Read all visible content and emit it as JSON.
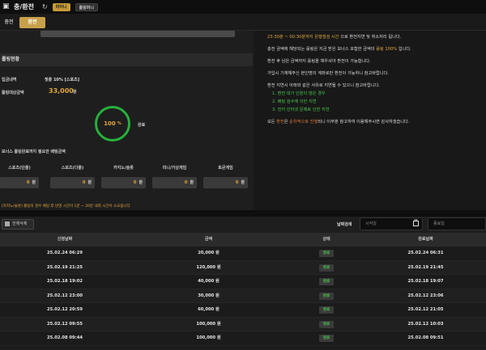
{
  "header": {
    "title": "충/환전",
    "pill_primary": "마이니",
    "pill_secondary": "롤링머니"
  },
  "tabs": [
    {
      "label": "충전"
    },
    {
      "label": "환전"
    }
  ],
  "left": {
    "input_stub": "⁣⁣⁣⁣⁣⁣⁣⁣⁣⁣⁣⁣⁣⁣",
    "section_title": "롤링현황",
    "deposit_label": "입금내역",
    "deposit_value": "첫충 10% [스포츠]",
    "target_label": "롤링대상금액",
    "target_value": "33,000",
    "target_unit": "원",
    "progress_value": 100,
    "progress_unit": "%",
    "progress_label": "완료",
    "bonus_label": "보너스 롤링완료까지 필요한 배팅금액",
    "categories": [
      {
        "name": "스포츠(단폴)",
        "value": "0",
        "unit": "원"
      },
      {
        "name": "스포츠(다폴)",
        "value": "0",
        "unit": "원"
      },
      {
        "name": "카지노/슬롯",
        "value": "0",
        "unit": "원"
      },
      {
        "name": "미니/가상게임",
        "value": "0",
        "unit": "원"
      },
      {
        "name": "토큰게임",
        "value": "0",
        "unit": "원"
      }
    ],
    "note": "[카지노/슬롯] 롤링의 경우 배팅 후 반영 시간이 1분 ~ 20분 내외 시간이 소요됩니다"
  },
  "right": {
    "line1_time": "23:30분 ~ 00:30분까지 은행점검 시간",
    "line1_rest": " 으로 환전지연 및 취소처리 됩니다.",
    "line2_a": "충전 금액에 해당되는 롤링은 지금 받은 보너스 포함한 금액의 ",
    "line2_b": "롤링 100%",
    "line2_c": " 입니다.",
    "line3": "환전 후 남은 금액까지 롤링을 채우셔야 환전이 가능합니다.",
    "line4": "가입시 기재해주신 본인명의 계좌로만 환전이 가능하니 참고바랍니다.",
    "line5": "환전 지연시 아래와 같은 사유로 지연될 수 있으니 참고바랍니다.",
    "reasons": [
      "1. 환전 대기 인원이 많은 경우",
      "2. 배팅 검수에 의한 지연",
      "3. 전지 인터넷 문제로 인한 지연"
    ],
    "line6_a": "모든 ",
    "line6_b": "환전",
    "line6_c": "은 ",
    "line6_d": "순차적으로 진행",
    "line6_e": "되니 이부분 참고하여 이용해주시면 감사하겠습니다."
  },
  "filter": {
    "delete_all": "전체삭제",
    "date_label": "날짜검색",
    "start_placeholder": "시작일",
    "end_placeholder": "종료일"
  },
  "table": {
    "headers": [
      "신청날짜",
      "금액",
      "상태",
      "완료날짜"
    ],
    "rows": [
      {
        "date": "25.02.24 06:29",
        "amount": "20,000 원",
        "status": "완료",
        "done": "25.02.24 06:31"
      },
      {
        "date": "25.02.19 21:25",
        "amount": "120,000 원",
        "status": "완료",
        "done": "25.02.19 21:45"
      },
      {
        "date": "25.02.18 19:02",
        "amount": "40,000 원",
        "status": "완료",
        "done": "25.02.18 19:07"
      },
      {
        "date": "25.02.12 23:00",
        "amount": "30,000 원",
        "status": "완료",
        "done": "25.02.12 23:06"
      },
      {
        "date": "25.02.12 20:59",
        "amount": "60,000 원",
        "status": "완료",
        "done": "25.02.12 21:05"
      },
      {
        "date": "25.02.12 09:55",
        "amount": "100,000 원",
        "status": "완료",
        "done": "25.02.12 10:03"
      },
      {
        "date": "25.02.08 09:44",
        "amount": "100,000 원",
        "status": "완료",
        "done": "25.02.08 09:51"
      }
    ]
  }
}
